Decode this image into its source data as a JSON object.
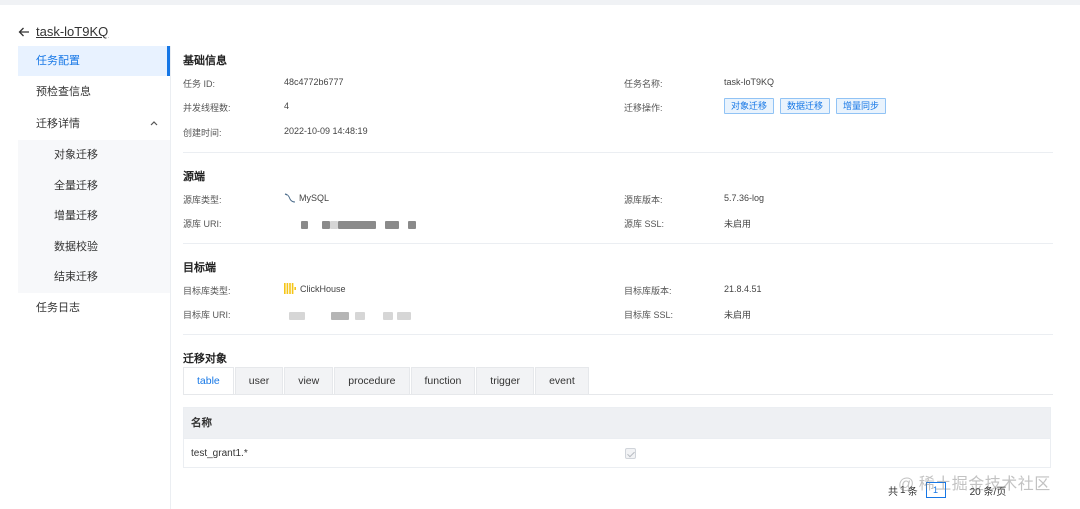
{
  "header": {
    "task_title": "task-loT9KQ"
  },
  "sidebar": {
    "items": [
      {
        "label": "任务配置"
      },
      {
        "label": "预检查信息"
      },
      {
        "label": "迁移详情"
      },
      {
        "label": "任务日志"
      }
    ],
    "sub_items": [
      {
        "label": "对象迁移"
      },
      {
        "label": "全量迁移"
      },
      {
        "label": "增量迁移"
      },
      {
        "label": "数据校验"
      },
      {
        "label": "结束迁移"
      }
    ]
  },
  "basic": {
    "title": "基础信息",
    "task_id_label": "任务 ID:",
    "task_id": "48c4772b6777",
    "task_name_label": "任务名称:",
    "task_name": "task-loT9KQ",
    "concurrency_label": "并发线程数:",
    "concurrency": "4",
    "operation_label": "迁移操作:",
    "operations": [
      "对象迁移",
      "数据迁移",
      "增量同步"
    ],
    "created_label": "创建时间:",
    "created": "2022-10-09 14:48:19"
  },
  "source": {
    "title": "源端",
    "type_label": "源库类型:",
    "type": "MySQL",
    "type_icon": "mysql-dolphin-icon",
    "version_label": "源库版本:",
    "version": "5.7.36-log",
    "uri_label": "源库 URI:",
    "ssl_label": "源库 SSL:",
    "ssl": "未启用"
  },
  "target": {
    "title": "目标端",
    "type_label": "目标库类型:",
    "type": "ClickHouse",
    "type_icon": "clickhouse-bars-icon",
    "version_label": "目标库版本:",
    "version": "21.8.4.51",
    "uri_label": "目标库 URI:",
    "ssl_label": "目标库 SSL:",
    "ssl": "未启用"
  },
  "objects": {
    "title": "迁移对象",
    "tabs": [
      "table",
      "user",
      "view",
      "procedure",
      "function",
      "trigger",
      "event"
    ],
    "column_header": "名称",
    "rows": [
      {
        "name": "test_grant1.*",
        "checked": true
      }
    ]
  },
  "pagination": {
    "total_prefix": "共",
    "total": "1",
    "total_suffix": "条",
    "current_page": "1",
    "page_size": "20 条/页"
  },
  "watermark": {
    "at": "@",
    "text": "稀土掘金技术社区"
  },
  "colors": {
    "accent": "#1677e6",
    "active_bg": "#e8f2ff",
    "tag_bg": "#e9f3fd"
  }
}
